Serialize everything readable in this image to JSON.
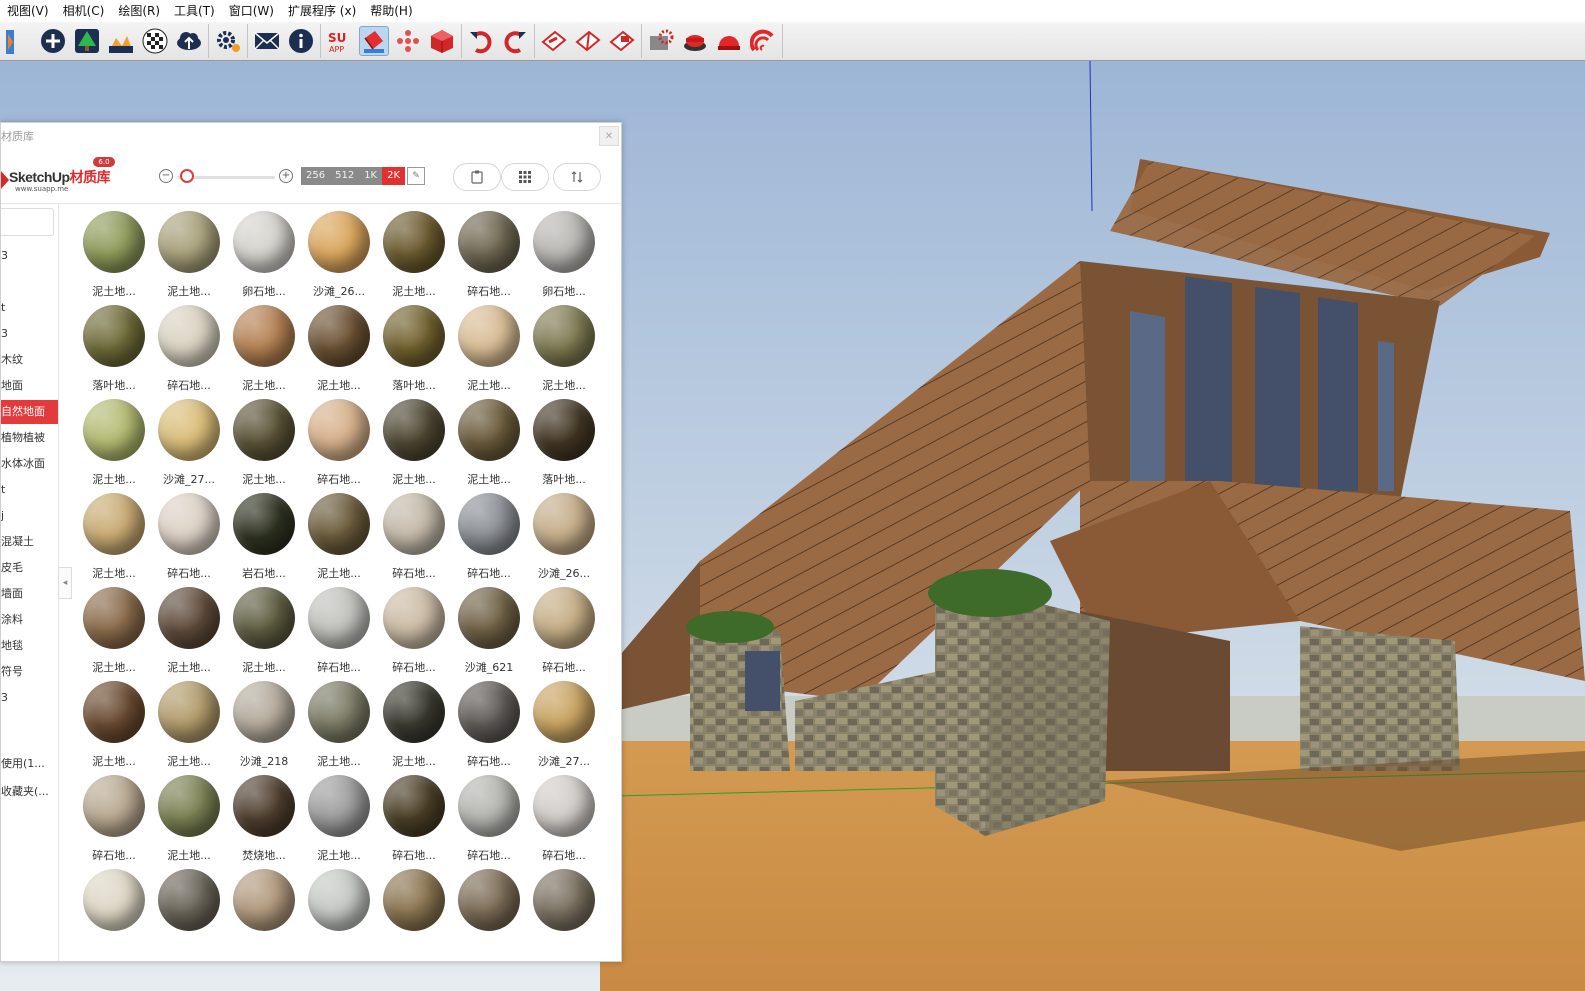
{
  "menu": [
    "视图(V)",
    "相机(C)",
    "绘图(R)",
    "工具(T)",
    "窗口(W)",
    "扩展程序 (x)",
    "帮助(H)"
  ],
  "toolbar": {
    "groups": [
      [
        "select-arrow-icon",
        "add-circle-icon",
        "tree-upload-icon",
        "terrain-icon",
        "checker-icon",
        "cloud-upload-icon"
      ],
      [
        "gear-settings-icon"
      ],
      [
        "mail-icon",
        "info-icon"
      ],
      [
        "suapp-icon",
        "paint-bucket-icon",
        "component-dots-icon",
        "red-cube-icon"
      ],
      [
        "undo-icon",
        "redo-icon"
      ],
      [
        "section-red-icon",
        "section-red2-icon",
        "section-red3-icon"
      ],
      [
        "render-gear-icon",
        "render-red-button-icon",
        "render-helmet-icon",
        "render-swirl-icon"
      ]
    ],
    "active": "paint-bucket-icon"
  },
  "panel": {
    "title": "材质库",
    "logo_text": "SketchUp",
    "logo_text_red": "材质库",
    "logo_url": "www.suapp.me",
    "logo_badge": "6.0",
    "zoom_out": "−",
    "zoom_in": "+",
    "resolutions": [
      "256",
      "512",
      "1K",
      "2K"
    ],
    "selected_resolution": "2K",
    "slider_value": 0.05,
    "header_buttons": [
      "clipboard-icon",
      "grid-icon",
      "sort-icon"
    ],
    "collapse": "◂"
  },
  "sidebar": {
    "categories": [
      "3",
      "",
      "t",
      "3",
      "木纹",
      "地面",
      "自然地面",
      "植物植被",
      "水体冰面",
      "t",
      "j",
      "混凝土",
      "皮毛",
      "墙面",
      "涂料",
      "地毯",
      "符号",
      "3",
      "",
      "使用(1...",
      "收藏夹(..."
    ],
    "selected": "自然地面"
  },
  "materials": [
    {
      "label": "泥土地...",
      "color": "#8e9a5a"
    },
    {
      "label": "泥土地...",
      "color": "#a8a07a"
    },
    {
      "label": "卵石地...",
      "color": "#d4d2cc"
    },
    {
      "label": "沙滩_26...",
      "color": "#d9a55c"
    },
    {
      "label": "泥土地...",
      "color": "#6b5a2e"
    },
    {
      "label": "碎石地...",
      "color": "#6e6650"
    },
    {
      "label": "卵石地...",
      "color": "#b8b6b2"
    },
    {
      "label": "落叶地...",
      "color": "#6e6a38"
    },
    {
      "label": "碎石地...",
      "color": "#d8d2c0"
    },
    {
      "label": "泥土地...",
      "color": "#b48052"
    },
    {
      "label": "泥土地...",
      "color": "#6a5032"
    },
    {
      "label": "落叶地...",
      "color": "#71612e"
    },
    {
      "label": "泥土地...",
      "color": "#d8bc94"
    },
    {
      "label": "泥土地...",
      "color": "#7e7a52"
    },
    {
      "label": "泥土地...",
      "color": "#b2ba70"
    },
    {
      "label": "沙滩_27...",
      "color": "#d9bc78"
    },
    {
      "label": "泥土地...",
      "color": "#5a5236"
    },
    {
      "label": "碎石地...",
      "color": "#d6b08a"
    },
    {
      "label": "泥土地...",
      "color": "#4e4632"
    },
    {
      "label": "泥土地...",
      "color": "#6a5a3a"
    },
    {
      "label": "落叶地...",
      "color": "#423624"
    },
    {
      "label": "泥土地...",
      "color": "#c8aa72"
    },
    {
      "label": "碎石地...",
      "color": "#dcd0c4"
    },
    {
      "label": "岩石地...",
      "color": "#2e3220"
    },
    {
      "label": "泥土地...",
      "color": "#6a5a3a"
    },
    {
      "label": "碎石地...",
      "color": "#c2b8a8"
    },
    {
      "label": "碎石地...",
      "color": "#8a8e94"
    },
    {
      "label": "沙滩_26...",
      "color": "#c4ac88"
    },
    {
      "label": "泥土地...",
      "color": "#8a6a4a"
    },
    {
      "label": "泥土地...",
      "color": "#5e4a3a"
    },
    {
      "label": "泥土地...",
      "color": "#5e5c40"
    },
    {
      "label": "碎石地...",
      "color": "#c0c0bc"
    },
    {
      "label": "碎石地...",
      "color": "#cabaa4"
    },
    {
      "label": "沙滩_621",
      "color": "#6e6044"
    },
    {
      "label": "碎石地...",
      "color": "#c4ac84"
    },
    {
      "label": "泥土地...",
      "color": "#6a4a30"
    },
    {
      "label": "泥土地...",
      "color": "#b09a6a"
    },
    {
      "label": "沙滩_218",
      "color": "#b4aa9c"
    },
    {
      "label": "泥土地...",
      "color": "#7a7a64"
    },
    {
      "label": "泥土地...",
      "color": "#3a3a30"
    },
    {
      "label": "碎石地...",
      "color": "#5e5a56"
    },
    {
      "label": "沙滩_27...",
      "color": "#c8a260"
    },
    {
      "label": "碎石地...",
      "color": "#b8a890"
    },
    {
      "label": "泥土地...",
      "color": "#7a8052"
    },
    {
      "label": "焚烧地...",
      "color": "#4e3e2e"
    },
    {
      "label": "泥土地...",
      "color": "#9c9c9c"
    },
    {
      "label": "碎石地...",
      "color": "#4a3e26"
    },
    {
      "label": "碎石地...",
      "color": "#b4b4b0"
    },
    {
      "label": "碎石地...",
      "color": "#d0ccc8"
    },
    {
      "label": "",
      "color": "#dcd6c4"
    },
    {
      "label": "",
      "color": "#6a6458"
    },
    {
      "label": "",
      "color": "#b0987c"
    },
    {
      "label": "",
      "color": "#c4c8c4"
    },
    {
      "label": "",
      "color": "#8a7450"
    },
    {
      "label": "",
      "color": "#7a6a54"
    },
    {
      "label": "",
      "color": "#7a7060"
    }
  ]
}
